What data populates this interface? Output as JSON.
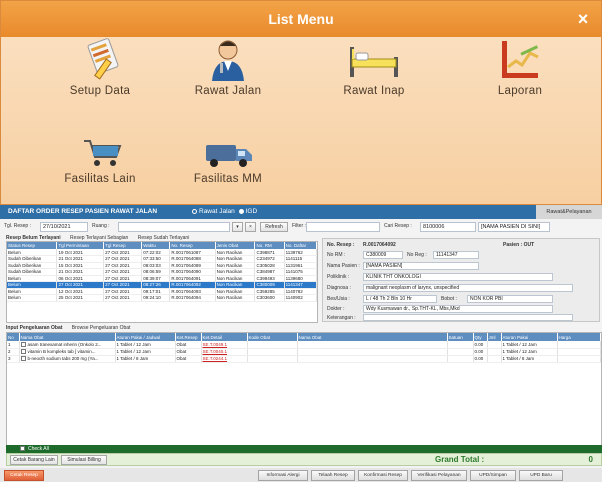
{
  "menu": {
    "title": "List Menu",
    "close": "×",
    "items": [
      {
        "label": "Setup Data",
        "icon": "setup-data-icon"
      },
      {
        "label": "Rawat Jalan",
        "icon": "doctor-icon"
      },
      {
        "label": "Rawat Inap",
        "icon": "hospital-bed-icon"
      },
      {
        "label": "Laporan",
        "icon": "report-chart-icon"
      },
      {
        "label": "Fasilitas Lain",
        "icon": "cart-icon"
      },
      {
        "label": "Fasilitas MM",
        "icon": "ambulance-icon"
      }
    ]
  },
  "resep": {
    "title": "DAFTAR ORDER RESEP PASIEN RAWAT JALAN",
    "radio_a": "Rawat Jalan",
    "radio_b": "IGD",
    "brand": "Rawat&Pelayanan",
    "tgl_label": "Tgl. Resep :",
    "tgl_value": "27/10/2021",
    "ruang_label": "Ruang :",
    "refresh": "Refresh",
    "filter_label": "Filter :",
    "cari_label": "Cari Resep :",
    "cari_value": "8100006",
    "cari_name": "[NAMA PASIEN DI SINI]",
    "tabs": [
      "Resep Belum Terlayani",
      "Resep Terlayani Sebagian",
      "Resep Sudah Terlayani"
    ],
    "grid_headers": [
      "Status Resep",
      "Tgl Permintaan",
      "Tgl Resep",
      "Waktu",
      "No. Resep",
      "Jenis Obat",
      "No. RM",
      "No. Daftar"
    ],
    "grid_rows": [
      [
        "Belum",
        "19 Oct 2021",
        "27 Oct 2021",
        "07:22:02",
        "R.0017061087",
        "Non Racikan",
        "C398871",
        "1139762"
      ],
      [
        "Sudah Diberikan",
        "21 Oct 2021",
        "27 Oct 2021",
        "07:33:50",
        "R.0017064088",
        "Non Racikan",
        "C234972",
        "1141115"
      ],
      [
        "Sudah Diberikan",
        "15 Oct 2021",
        "27 Oct 2021",
        "08:03:03",
        "R.0017064089",
        "Non Racikan",
        "C305028",
        "1131961"
      ],
      [
        "Sudah Diberikan",
        "21 Oct 2021",
        "27 Oct 2021",
        "08:06:59",
        "R.0017064090",
        "Non Racikan",
        "C384987",
        "1141075"
      ],
      [
        "Belum",
        "06 Oct 2021",
        "27 Oct 2021",
        "08:39:07",
        "R.0017064091",
        "Non Racikan",
        "C399493",
        "1139680"
      ],
      [
        "Belum",
        "27 Oct 2021",
        "27 Oct 2021",
        "08:27:26",
        "R.0017064092",
        "Non Racikan",
        "C380009",
        "1141347"
      ],
      [
        "Belum",
        "12 Oct 2021",
        "27 Oct 2021",
        "09:17:01",
        "R.0017064093",
        "Non Racikan",
        "C359285",
        "1140782"
      ],
      [
        "Belum",
        "25 Oct 2021",
        "27 Oct 2021",
        "09:24:10",
        "R.0017064094",
        "Non Racikan",
        "C303600",
        "1140902"
      ]
    ],
    "selected_row": 5,
    "detail": {
      "no_resep_label": "No. Resep :",
      "no_resep": "R.0017064092",
      "pasien_label": "Pasien : OUT",
      "no_rm_label": "No RM :",
      "no_rm": "C380009",
      "no_reg_label": "No Reg :",
      "no_reg": "11141347",
      "nama_label": "Nama Pasien :",
      "nama": "[NAMA PASIEN]",
      "poli_label": "Poliklinik :",
      "poli": "KLINIK THT ONKOLOGI",
      "diag_label": "Diagnosa :",
      "diag": "malignant neoplasm of larynx, unspecified",
      "dokter_label": "Dokter :",
      "dokter": "Wdy Kusmawan dr., Sp.THT-KL, Mbs,Mkd",
      "bbu_label": "Bes/Usia :",
      "bbu": "L / 48 Th 2 Bln 10 Hr",
      "bobot_label": "Bobot :",
      "bobot": "NON KOR PBI",
      "ket_label": "Keterangan :"
    },
    "bottom_tabs": [
      "Input Pengeluaran Obat",
      "Browse Pengeluaran Obat"
    ],
    "bgrid_headers": [
      "No",
      "Nama Obat",
      "Aturan Pakai / Jadwal",
      "Ket.Resep",
      "Ket.Detail",
      "Kode Obat",
      "Nama Obat",
      "Satuan",
      "Qty",
      "Jml",
      "Aturan Pakai",
      "Harga"
    ],
    "bgrid_rows": [
      [
        "1",
        "asam tranexamat inherin (Onkolo 2...",
        "1 Tablet",
        "12 Jam",
        "Obat",
        "SE.T.0049.1",
        "0.00",
        "1 Tablet / 12 Jam"
      ],
      [
        "2",
        "vitamin B kompleks tab [ vitamin...",
        "1 Tablet",
        "12 Jam",
        "Obat",
        "SE.T.0040.1",
        "0.00",
        "1 Tablet / 12 Jam"
      ],
      [
        "3",
        "b-neocth sodium tabs 200 mg (Ya...",
        "1 Tablet",
        "8 Jam",
        "Obat",
        "SE.T.0244.1",
        "0.00",
        "1 Tablet / 8 Jam"
      ]
    ],
    "check_all": "Check All",
    "grand_total_label": "Grand Total :",
    "grand_total": "0",
    "footer_buttons": [
      "Cetak Barang Lain",
      "Simulasi Billing",
      "Informasi Alergi",
      "Telaah Resep",
      "Konfirmasi Resep",
      "Verifikasi Pelayanan",
      "UPD/Simpan",
      "UPD Baru"
    ],
    "cetak_resep": "Cetak Resep"
  }
}
